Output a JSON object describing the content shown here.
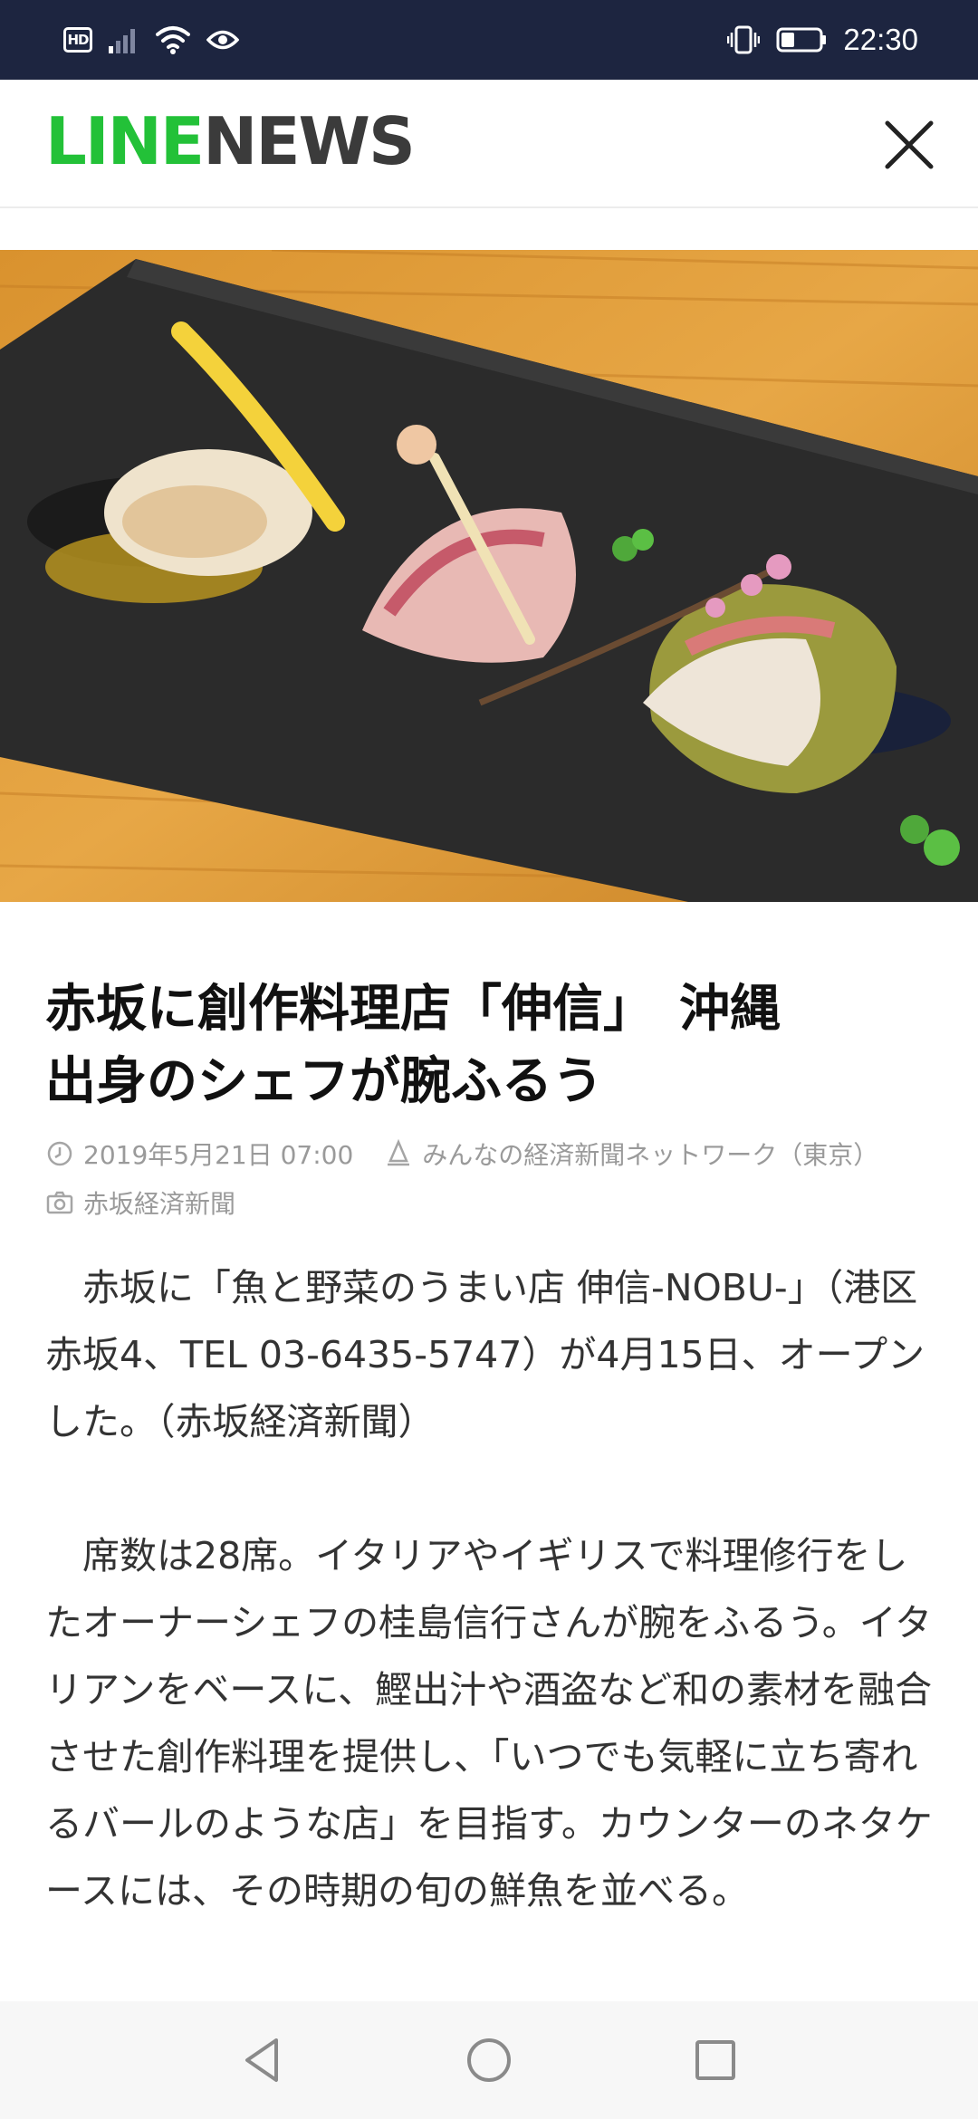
{
  "status_bar": {
    "hd_label": "HD",
    "time": "22:30",
    "battery_percent": 35
  },
  "header": {
    "brand_line": "LINE",
    "brand_news": "NEWS",
    "accent_color": "#23c138"
  },
  "article": {
    "headline": "赤坂に創作料理店「伸信」　沖縄\n出身のシェフが腕ふるう",
    "date": "2019年5月21日 07:00",
    "publisher": "みんなの経済新聞ネットワーク（東京）",
    "source": "赤坂経済新聞",
    "paragraphs": [
      "赤坂に「魚と野菜のうまい店 伸信-NOBU-」（港区赤坂4、TEL 03-6435-5747）が4月15日、オープンした。（赤坂経済新聞）",
      "席数は28席。イタリアやイギリスで料理修行をしたオーナーシェフの桂島信行さんが腕をふるう。イタリアンをベースに、鰹出汁や酒盗など和の素材を融合させた創作料理を提供し、「いつでも気軽に立ち寄れるバールのような店」を目指す。カウンターのネタケースには、その時期の旬の鮮魚を並べる。"
    ]
  },
  "icons": {
    "close": "close-icon",
    "back": "back-icon",
    "home": "home-icon",
    "recents": "recents-icon"
  }
}
